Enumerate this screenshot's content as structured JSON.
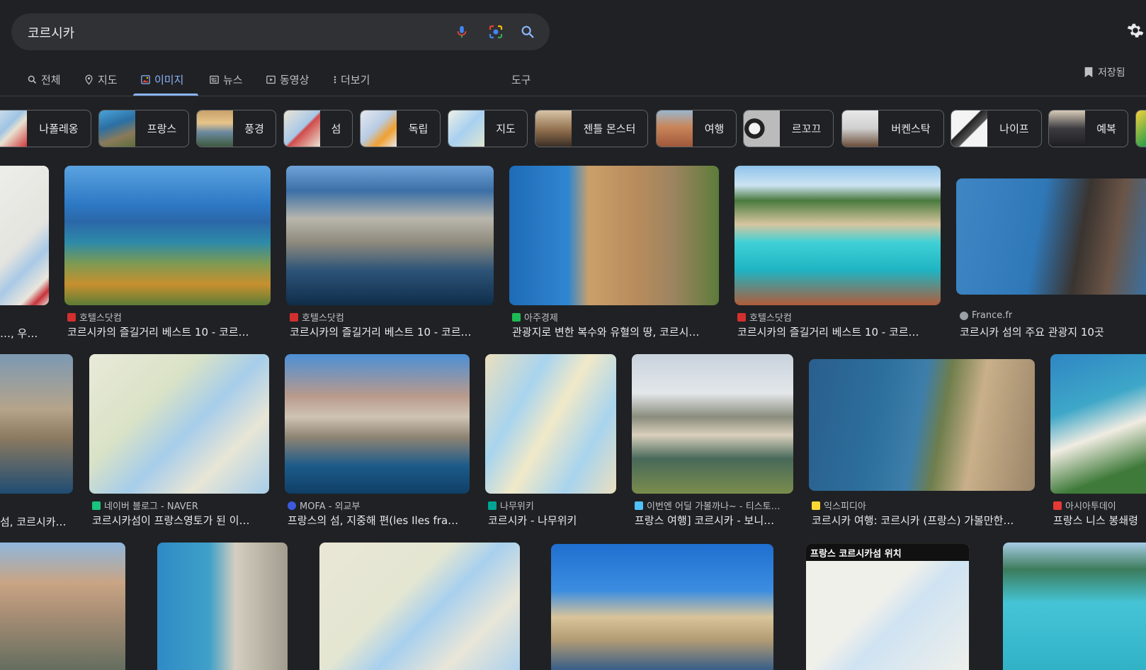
{
  "search": {
    "query": "코르시카"
  },
  "tabs": [
    {
      "label": "전체",
      "icon": "search-icon"
    },
    {
      "label": "지도",
      "icon": "map-pin-icon"
    },
    {
      "label": "이미지",
      "icon": "image-icon",
      "active": true
    },
    {
      "label": "뉴스",
      "icon": "news-icon"
    },
    {
      "label": "동영상",
      "icon": "video-icon"
    },
    {
      "label": "더보기",
      "icon": "more-vert-icon"
    }
  ],
  "tools_label": "도구",
  "saved_label": "저장됨",
  "chips": [
    {
      "label": "나폴레옹"
    },
    {
      "label": "프랑스"
    },
    {
      "label": "풍경"
    },
    {
      "label": "섬"
    },
    {
      "label": "독립"
    },
    {
      "label": "지도"
    },
    {
      "label": "젠틀 몬스터"
    },
    {
      "label": "여행"
    },
    {
      "label": "르꼬끄"
    },
    {
      "label": "버켄스탁"
    },
    {
      "label": "나이프"
    },
    {
      "label": "예복"
    }
  ],
  "row1": [
    {
      "source": "",
      "title": "…, 우리 …"
    },
    {
      "source": "호텔스닷컴",
      "title": "코르시카의 즐길거리 베스트 10 - 코르…",
      "favicon_color": "#d32f2f"
    },
    {
      "source": "호텔스닷컴",
      "title": "코르시카의 즐길거리 베스트 10 - 코르…",
      "favicon_color": "#d32f2f"
    },
    {
      "source": "아주경제",
      "title": "관광지로 변한 복수와 유혈의 땅, 코르시…",
      "favicon_color": "#1db954"
    },
    {
      "source": "호텔스닷컴",
      "title": "코르시카의 즐길거리 베스트 10 - 코르…",
      "favicon_color": "#d32f2f"
    },
    {
      "source": "France.fr",
      "title": "코르시카 섬의 주요 관광지 10곳",
      "favicon_color": "#9aa0a6"
    }
  ],
  "row2": [
    {
      "source": "",
      "title": "섬, 코르시카…"
    },
    {
      "source": "네이버 블로그 - NAVER",
      "title": "코르시카섬이 프랑스영토가 된 이…",
      "favicon_color": "#19c37d"
    },
    {
      "source": "MOFA - 외교부",
      "title": "프랑스의 섬, 지중해 편(les Iles fra…",
      "favicon_color": "#3b5bdb"
    },
    {
      "source": "나무위키",
      "title": "코르시카 - 나무위키",
      "favicon_color": "#00a495"
    },
    {
      "source": "이번엔 어딜 가볼까나~ - 티스토…",
      "title": "프랑스 여행] 코르시카 - 보니…",
      "favicon_color": "#4fc3f7"
    },
    {
      "source": "익스피디아",
      "title": "코르시카 여행: 코르시카 (프랑스) 가볼만한…",
      "favicon_color": "#fdd835"
    },
    {
      "source": "아시아투데이",
      "title": "프랑스 니스 봉쇄령",
      "favicon_color": "#e53935"
    }
  ],
  "row3_map_label": "프랑스 코르시카섬 위치",
  "colors": {
    "background": "#202124",
    "accent": "#8ab4f8",
    "text": "#e8eaed"
  }
}
